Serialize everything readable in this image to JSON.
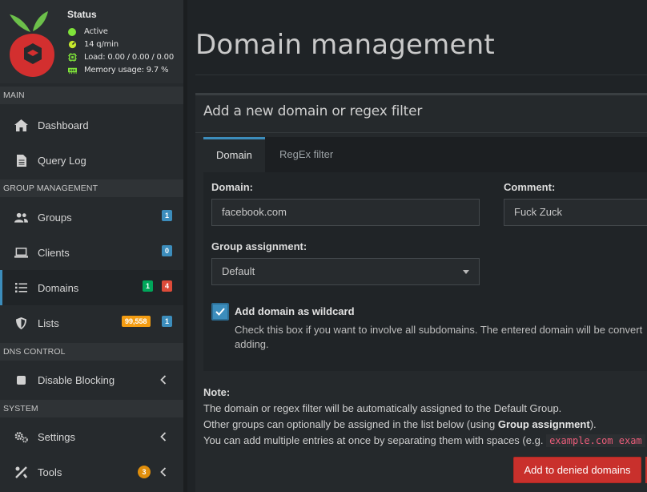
{
  "status": {
    "title": "Status",
    "active": "Active",
    "queries": "14 q/min",
    "load": "Load: 0.00 / 0.00 / 0.00",
    "memory": "Memory usage: 9.7 %"
  },
  "sidebar": {
    "sections": {
      "main": "MAIN",
      "group": "GROUP MANAGEMENT",
      "dns": "DNS CONTROL",
      "system": "SYSTEM"
    },
    "items": {
      "dashboard": "Dashboard",
      "query_log": "Query Log",
      "groups": "Groups",
      "clients": "Clients",
      "domains": "Domains",
      "lists": "Lists",
      "disable_blocking": "Disable Blocking",
      "settings": "Settings",
      "tools": "Tools"
    },
    "badges": {
      "groups": "1",
      "clients": "0",
      "domains_allowed": "1",
      "domains_denied": "4",
      "lists_domains": "99,558",
      "lists_count": "1",
      "tools": "3"
    }
  },
  "main": {
    "page_title": "Domain management",
    "card_title": "Add a new domain or regex filter",
    "tabs": [
      "Domain",
      "RegEx filter"
    ],
    "form": {
      "domain_label": "Domain:",
      "domain_value": "facebook.com",
      "comment_label": "Comment:",
      "comment_value": "Fuck Zuck",
      "group_label": "Group assignment:",
      "group_value": "Default",
      "wildcard_label": "Add domain as wildcard",
      "wildcard_help_1": "Check this box if you want to involve all subdomains. The entered domain will be convert",
      "wildcard_help_2": "adding."
    },
    "note": {
      "title": "Note:",
      "line1": "The domain or regex filter will be automatically assigned to the Default Group.",
      "line2_pre": "Other groups can optionally be assigned in the list below (using ",
      "line2_bold": "Group assignment",
      "line2_post": ").",
      "line3_pre": "You can add multiple entries at once by separating them with spaces (e.g. ",
      "line3_code": "example.com exam"
    },
    "deny_button": "Add to denied domains"
  },
  "colors": {
    "accent": "#3c8dbc",
    "danger": "#c9302c",
    "success": "#00a65a",
    "warning": "#f39c12"
  }
}
